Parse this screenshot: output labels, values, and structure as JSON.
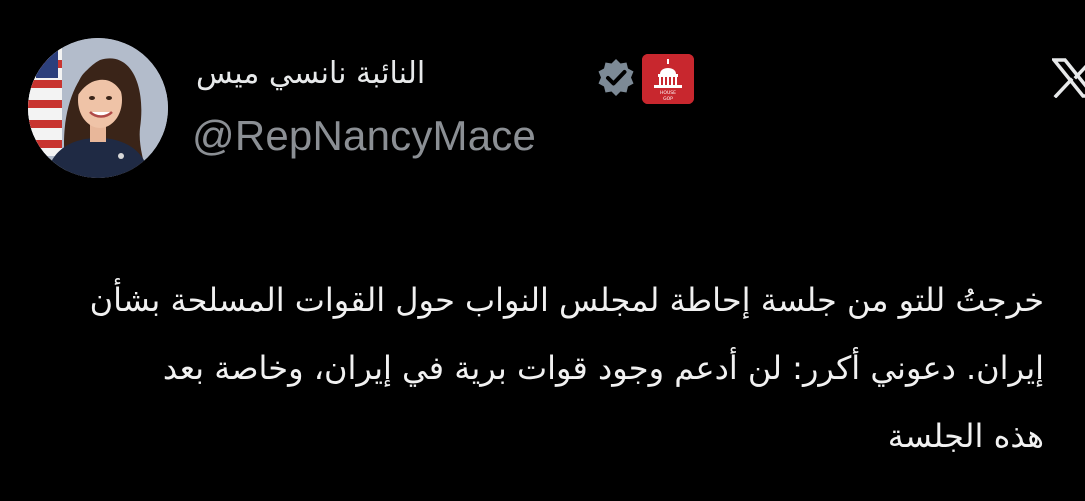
{
  "author": {
    "display_name": "النائبة نانسي ميس",
    "handle": "@RepNancyMace",
    "avatar_icon": "profile-photo",
    "verified_icon": "verified-badge-icon",
    "affiliation_icon": "house-gop-badge-icon",
    "affiliation_badge_text": "HOUSE GOP",
    "verified_color": "#7d8a96",
    "affiliation_color": "#c8272e"
  },
  "platform": {
    "logo_icon": "x-logo-icon"
  },
  "tweet": {
    "lines": [
      "خرجتُ للتو من جلسة إحاطة لمجلس النواب حول القوات المسلحة بشأن",
      "إيران. دعوني أكرر: لن أدعم وجود قوات برية في إيران، وخاصة بعد",
      "هذه الجلسة"
    ]
  },
  "colors": {
    "background": "#000000",
    "text": "#f1f1f1",
    "handle": "#8b8f94"
  }
}
